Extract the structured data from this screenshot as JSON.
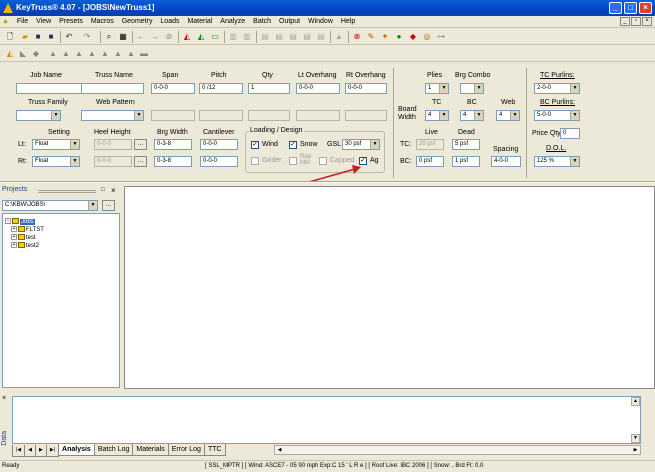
{
  "window": {
    "title": "KeyTruss® 4.07 - [JOBS\\NewTruss1]"
  },
  "menu": [
    "File",
    "View",
    "Presets",
    "Macros",
    "Geometry",
    "Loads",
    "Material",
    "Analyze",
    "Batch",
    "Output",
    "Window",
    "Help"
  ],
  "labels": {
    "job_name": "Job Name",
    "truss_name": "Truss Name",
    "span": "Span",
    "pitch": "Pitch",
    "qty": "Qty",
    "lt_overhang": "Lt Overhang",
    "rt_overhang": "Rt Overhang",
    "plies": "Plies",
    "brg_combo": "Brg Combo",
    "tc_purlins": "TC Purlins:",
    "truss_family": "Truss Family",
    "web_pattern": "Web Pattern",
    "board_width": "Board Width",
    "tc": "TC",
    "bc": "BC",
    "web": "Web",
    "bc_purlins": "BC Purlins:",
    "setting": "Setting",
    "heel_height": "Heel Height",
    "brg_width": "Brg Width",
    "cantilever": "Cantilever",
    "loading_design": "Loading / Design",
    "wind": "Wind",
    "snow": "Snow",
    "gsl": "GSL",
    "girder": "Girder",
    "rep_mbr": "Rep Mbr",
    "capped": "Capped",
    "ag": "Ag",
    "live": "Live",
    "dead": "Dead",
    "spacing": "Spacing",
    "price_qty": "Price Qty",
    "dol": "D.O.L.",
    "lt": "Lt:",
    "rt": "Rt:",
    "tc_row": "TC:",
    "bc_row": "BC:"
  },
  "values": {
    "span": "0-0-0",
    "pitch": "0 /12",
    "qty": "1",
    "lt_overhang": "0-0-0",
    "rt_overhang": "0-0-0",
    "plies": "1",
    "tc_purlins": "2-0-0",
    "bc_purlins": "5-0-0",
    "board_tc": "4",
    "board_bc": "4",
    "board_web": "4",
    "lt_setting": "Float",
    "rt_setting": "Float",
    "lt_heel": "0-0-0",
    "rt_heel": "0-0-0",
    "lt_brg": "0-3-8",
    "rt_brg": "0-3-8",
    "lt_cant": "0-0-0",
    "rt_cant": "0-0-0",
    "gsl": "30 psf",
    "tc_live": "20 psf",
    "tc_dead": "5 psf",
    "bc_live": "0 psf",
    "bc_dead": "1 psf",
    "spacing": "4-0-0",
    "price_qty": "0",
    "dol": "125 %"
  },
  "checks": {
    "wind": "✓",
    "snow": "✓",
    "girder": "",
    "rep_mbr": "",
    "capped": "",
    "ag": "✓"
  },
  "projects": {
    "title": "Projects",
    "path": "C:\\KBW\\JOBS\\",
    "tree": [
      "Jobs",
      "FLTST",
      "test",
      "test2"
    ]
  },
  "tabs": [
    "Analysis",
    "Batch Log",
    "Materials",
    "Error Log",
    "TTC"
  ],
  "data_panel_label": "Data",
  "status": {
    "left": "Ready",
    "info": "[ SSL_MPTR ] [ Wind: ASCE7 - 05 90 mph Exp:C 15 ' L R e ] [ Roof Live: IBC 2006 ] [ Snow: , Brd Ft: 0.0"
  }
}
